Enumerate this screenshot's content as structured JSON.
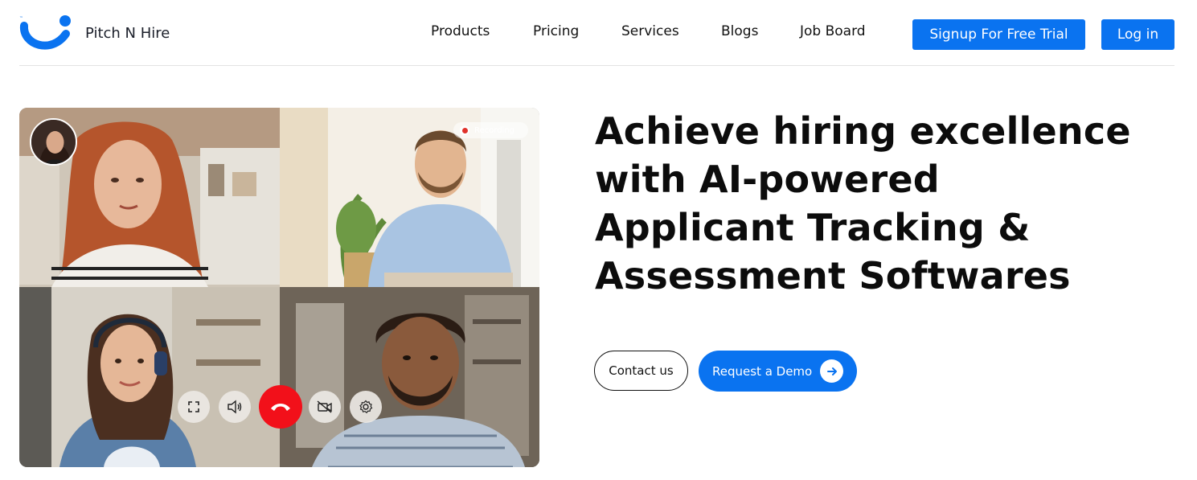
{
  "brand": {
    "name": "Pitch N Hire",
    "logo_icon": "smile-person-logo-icon",
    "accent_color": "#0a73f0"
  },
  "nav": {
    "items": [
      {
        "label": "Products"
      },
      {
        "label": "Pricing"
      },
      {
        "label": "Services"
      },
      {
        "label": "Blogs"
      },
      {
        "label": "Job Board"
      }
    ],
    "signup_label": "Signup For Free Trial",
    "login_label": "Log in"
  },
  "video_call": {
    "recording_label": "Recording",
    "controls": [
      {
        "icon": "fullscreen-icon"
      },
      {
        "icon": "speaker-icon"
      },
      {
        "icon": "end-call-icon",
        "color": "#f2101a"
      },
      {
        "icon": "camera-off-icon"
      },
      {
        "icon": "settings-icon"
      }
    ]
  },
  "hero": {
    "title_lines": [
      "Achieve hiring excellence",
      "with AI-powered",
      "Applicant Tracking &",
      "Assessment Softwares"
    ],
    "contact_label": "Contact us",
    "demo_label": "Request a Demo",
    "demo_icon": "arrow-right-icon"
  }
}
